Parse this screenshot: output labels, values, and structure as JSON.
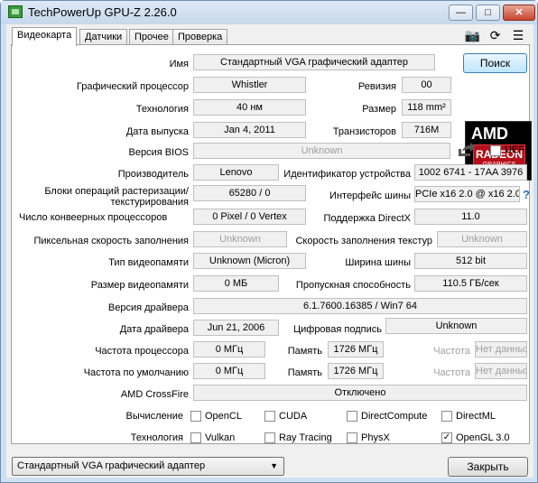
{
  "window": {
    "title": "TechPowerUp GPU-Z 2.26.0",
    "min_label": "—",
    "max_label": "□",
    "close_label": "✕"
  },
  "tabs": [
    "Видеокарта",
    "Датчики",
    "Прочее",
    "Проверка"
  ],
  "tab_icons": {
    "camera": "📷",
    "refresh": "⟳",
    "menu": "☰"
  },
  "labels": {
    "name": "Имя",
    "gpu": "Графический процессор",
    "revision": "Ревизия",
    "technology": "Технология",
    "die_size": "Размер",
    "release_date": "Дата выпуска",
    "transistors": "Транзисторов",
    "bios_version": "Версия BIOS",
    "uefi": "UEFI",
    "subvendor": "Производитель",
    "device_id": "Идентификатор устройства",
    "rops_tmus": "Блоки операций растеризации/текстурирования",
    "bus_interface": "Интерфейс шины",
    "shaders": "Число конвеерных процессоров",
    "directx": "Поддержка DirectX",
    "pixel_fillrate": "Пиксельная скорость заполнения",
    "texture_fillrate": "Скорость заполнения текстур",
    "memory_type": "Тип видеопамяти",
    "bus_width": "Ширина шины",
    "memory_size": "Размер видеопамяти",
    "bandwidth": "Пропускная способность",
    "driver_version": "Версия драйвера",
    "driver_date": "Дата драйвера",
    "digital_signature": "Цифровая подпись",
    "gpu_clock": "Частота процессора",
    "memory": "Память",
    "boost": "Частота",
    "default_clock": "Частота по умолчанию",
    "crossfire": "AMD CrossFire",
    "computing": "Вычисление",
    "technologies": "Технология"
  },
  "values": {
    "name": "Стандартный VGA графический адаптер",
    "gpu": "Whistler",
    "revision": "00",
    "technology": "40 нм",
    "die_size": "118 mm²",
    "release_date": "Jan 4, 2011",
    "transistors": "716M",
    "bios_version": "Unknown",
    "subvendor": "Lenovo",
    "device_id": "1002 6741 - 17AA 3976",
    "rops_tmus": "65280 / 0",
    "bus_interface": "PCIe x16 2.0 @ x16 2.0",
    "shaders": "0 Pixel / 0 Vertex",
    "directx": "11.0",
    "pixel_fillrate": "Unknown",
    "texture_fillrate": "Unknown",
    "memory_type": "Unknown (Micron)",
    "bus_width": "512 bit",
    "memory_size": "0 МБ",
    "bandwidth": "110.5 ГБ/сек",
    "driver_version": "6.1.7600.16385 / Win7 64",
    "driver_date": "Jun 21, 2006",
    "digital_signature": "Unknown",
    "gpu_clock": "0 МГц",
    "memory_clock": "1726 МГц",
    "boost": "Нет данных",
    "default_clock": "0 МГц",
    "default_memory": "1726 МГц",
    "default_boost": "Нет данных",
    "crossfire": "Отключено"
  },
  "lookup_button": "Поиск",
  "computing": [
    {
      "label": "OpenCL",
      "checked": false
    },
    {
      "label": "CUDA",
      "checked": false
    },
    {
      "label": "DirectCompute",
      "checked": false
    },
    {
      "label": "DirectML",
      "checked": false
    }
  ],
  "technologies": [
    {
      "label": "Vulkan",
      "checked": false
    },
    {
      "label": "Ray Tracing",
      "checked": false
    },
    {
      "label": "PhysX",
      "checked": false
    },
    {
      "label": "OpenGL 3.0",
      "checked": true
    }
  ],
  "logo": {
    "brand": "AMD",
    "line1": "RADEON",
    "line2": "GRAPHICS"
  },
  "footer": {
    "selected_adapter": "Стандартный VGA графический адаптер",
    "close_button": "Закрыть"
  },
  "colors": {
    "accent": "#3c7fb1",
    "amd_red": "#b50f19"
  }
}
